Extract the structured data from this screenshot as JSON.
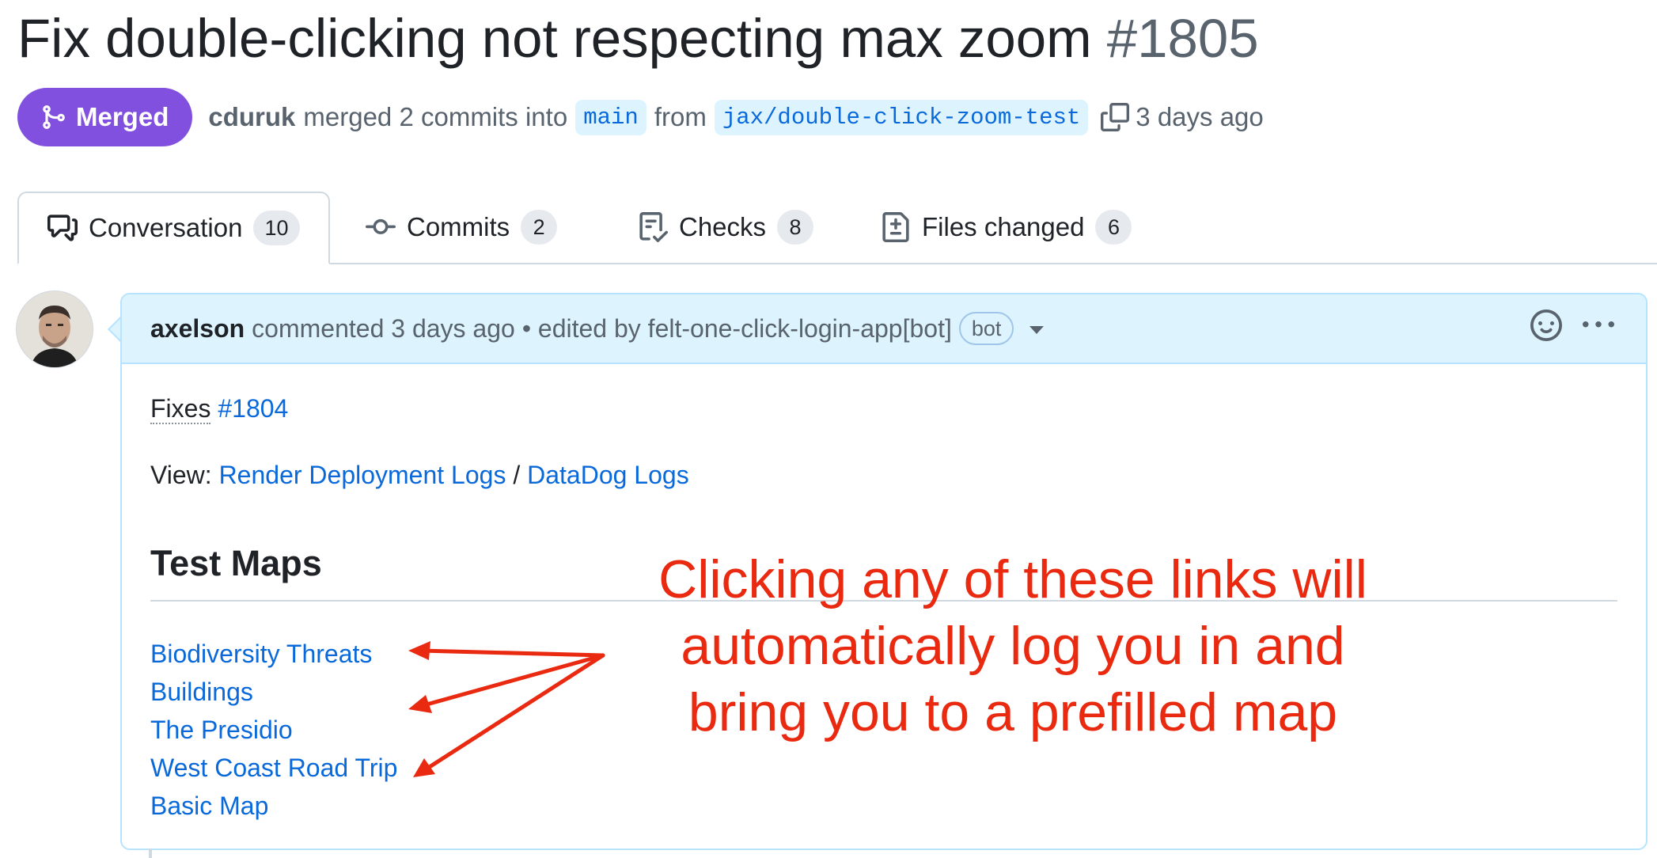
{
  "pr": {
    "title": "Fix double-clicking not respecting max zoom",
    "number": "#1805",
    "state": "Merged",
    "author": "cduruk",
    "merged_text": "merged 2 commits into",
    "base_branch": "main",
    "from_text": "from",
    "head_branch": "jax/double-click-zoom-test",
    "time": "3 days ago"
  },
  "tabs": [
    {
      "label": "Conversation",
      "count": "10",
      "icon": "comment-discussion-icon"
    },
    {
      "label": "Commits",
      "count": "2",
      "icon": "git-commit-icon"
    },
    {
      "label": "Checks",
      "count": "8",
      "icon": "checklist-icon"
    },
    {
      "label": "Files changed",
      "count": "6",
      "icon": "file-diff-icon"
    }
  ],
  "comment": {
    "author": "axelson",
    "commented_text": "commented 3 days ago",
    "edited_text": "• edited by felt-one-click-login-app[bot]",
    "bot_label": "bot",
    "body": {
      "fixes_label": "Fixes",
      "fixes_link": "#1804",
      "view_label": "View:",
      "render_logs": "Render Deployment Logs",
      "separator": "/",
      "datadog_logs": "DataDog Logs",
      "heading": "Test Maps",
      "maps": [
        "Biodiversity Threats",
        "Buildings",
        "The Presidio",
        "West Coast Road Trip",
        "Basic Map"
      ]
    }
  },
  "annotation": {
    "line1": "Clicking any of these links will",
    "line2": "automatically log you in and",
    "line3": "bring you to a prefilled map",
    "color": "#ea2a10"
  },
  "colors": {
    "merged": "#8250df",
    "link": "#0969da",
    "header_bg": "#ddf4ff"
  }
}
